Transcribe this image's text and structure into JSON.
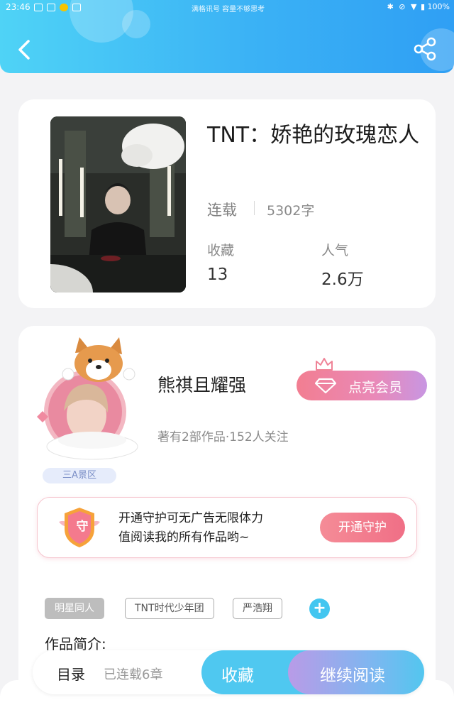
{
  "status_bar": {
    "time": "23:46",
    "carrier_text": "满格讯号 容量不够思考",
    "battery": "100%"
  },
  "header": {
    "back_icon": "chevron-left-icon",
    "share_icon": "share-icon"
  },
  "book": {
    "title": "TNT：娇艳的玫瑰恋人",
    "status": "连载",
    "word_count": "5302字",
    "favorites_label": "收藏",
    "favorites_value": "13",
    "popularity_label": "人气",
    "popularity_value": "2.6万"
  },
  "author": {
    "name": "熊祺且耀强",
    "meta": "著有2部作品·152人关注",
    "badge": "三A景区",
    "vip_button": "点亮会员"
  },
  "guard": {
    "icon_char": "守",
    "text_line1": "开通守护可无广告无限体力",
    "text_line2": "值阅读我的所有作品哟~",
    "button": "开通守护"
  },
  "tags": [
    "明星同人",
    "TNT时代少年团",
    "严浩翔"
  ],
  "intro_label": "作品简介:",
  "bottom_bar": {
    "toc": "目录",
    "chapters": "已连载6章",
    "favorite": "收藏",
    "continue": "继续阅读"
  },
  "colors": {
    "header_blue": "#3bb2f5",
    "accent_cyan": "#4fc8f0",
    "vip_pink": "#f27e91",
    "guard_pink": "#f06f86"
  }
}
